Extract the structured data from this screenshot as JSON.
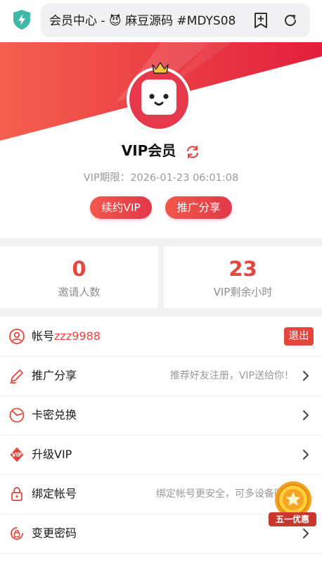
{
  "browser": {
    "url_text": "会员中心 - 😈 麻豆源码 #MDYS08",
    "shield_icon": "shield-bolt-icon",
    "bookmark_icon": "bookmark-add-icon",
    "refresh_icon": "refresh-icon"
  },
  "hero": {
    "title": "VIP会员",
    "expiry": "VIP期限：2026-01-23 06:01:08",
    "renew_label": "续约VIP",
    "share_label": "推广分享"
  },
  "stats": [
    {
      "value": "0",
      "label": "邀请人数"
    },
    {
      "value": "23",
      "label": "VIP剩余小时"
    }
  ],
  "menu": {
    "account": {
      "prefix": "帐号",
      "username": "zzz9988",
      "logout_label": "退出"
    },
    "items": [
      {
        "label": "推广分享",
        "hint": "推荐好友注册，VIP送给你！"
      },
      {
        "label": "卡密兑换",
        "hint": ""
      },
      {
        "label": "升级VIP",
        "hint": ""
      },
      {
        "label": "绑定帐号",
        "hint": "绑定帐号更安全，可多设备同步"
      },
      {
        "label": "变更密码",
        "hint": ""
      }
    ]
  },
  "promo": {
    "label": "五一优惠"
  },
  "colors": {
    "accent": "#e5473f",
    "brand_red": "#e2384b",
    "teal": "#3fb9a7"
  }
}
